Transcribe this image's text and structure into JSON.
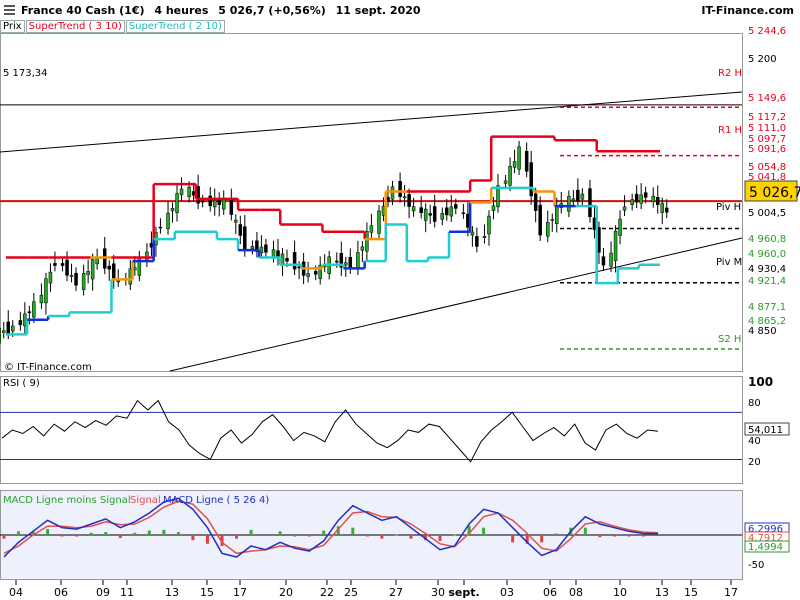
{
  "header": {
    "instrument": "France 40 Cash (1€)",
    "timeframe": "4 heures",
    "last": "5 026,7 (+0,56%)",
    "date": "11 sept. 2020",
    "brand": "IT-Finance.com"
  },
  "legend": {
    "price": "Prix",
    "supertrend_1": "SuperTrend ( 3 10)",
    "supertrend_2": "SuperTrend ( 2 10)"
  },
  "copyright": "© IT-Finance.com",
  "colors": {
    "supertrend_1": "#e8001a",
    "supertrend_2": "#22cccc",
    "supertrend_down": "#f0960a",
    "supertrend_up_dark": "#1030e0",
    "candle_up": "#22aa22",
    "rsi_line": "#000000",
    "macd_line": "#2030c0",
    "signal_line": "#e05050",
    "hist_pos": "#3caa3c",
    "hist_neg": "#e04040"
  },
  "price_panel": {
    "axis_ticks": [
      "5 200",
      "4 850"
    ],
    "current_price": "5 026,7",
    "level_5173": "5 173,34",
    "pivot_tags": [
      "5 244,6",
      "5 149,6",
      "5 117,2",
      "5 111,0",
      "5 097,7",
      "5 091,6",
      "5 054,8",
      "5 041,8",
      "5 004,5",
      "4 960,8",
      "4 960,0",
      "4 930,4",
      "4 921,4",
      "4 877,1",
      "4 865,2"
    ],
    "pivot_labels": {
      "r2": "R2 H",
      "r1": "R1 H",
      "piv": "Piv H",
      "piv_m": "Piv M",
      "s2": "S2 H"
    }
  },
  "chart_data": [
    {
      "type": "candlestick",
      "title": "France 40 Cash (1€)",
      "x_ticks": [
        "04",
        "06",
        "09",
        "11",
        "13",
        "15",
        "17",
        "20",
        "22",
        "25",
        "27",
        "30",
        "sept.",
        "03",
        "06",
        "08",
        "10",
        "13",
        "15",
        "17"
      ],
      "ylim": [
        4810,
        5270
      ],
      "y_ticks": [
        5200,
        4850
      ],
      "current_price": 5026.7,
      "horizontal_levels": [
        5173.34,
        5041.8
      ],
      "supertrend_3_10": [
        4965,
        4965,
        4965,
        4965,
        4965,
        4965,
        4965,
        5065,
        5065,
        5045,
        5045,
        5030,
        5030,
        5010,
        5010,
        5000,
        5000,
        4990,
        5055,
        5055,
        5055,
        5055,
        5070,
        5130,
        5130,
        5130,
        5125,
        5125,
        5110,
        5110,
        5110,
        5110
      ],
      "supertrend_2_10": [
        4860,
        4880,
        4885,
        4890,
        4890,
        4935,
        4960,
        4990,
        5000,
        5000,
        4990,
        4975,
        4965,
        4955,
        4950,
        4955,
        4950,
        4960,
        5010,
        4960,
        4965,
        5000,
        5040,
        5060,
        5060,
        5055,
        5035,
        5035,
        4930,
        4950,
        4955,
        4955
      ],
      "approx_close": [
        4870,
        4900,
        4960,
        4930,
        4965,
        4930,
        4960,
        5010,
        5060,
        5040,
        5040,
        4980,
        4975,
        4960,
        4940,
        4960,
        4955,
        5010,
        5060,
        5030,
        5020,
        5035,
        4980,
        5060,
        5110,
        5000,
        5040,
        5050,
        4950,
        5040,
        5050,
        5026.7
      ],
      "pivots": {
        "r2": 5170,
        "r1": 5104,
        "piv": 5004.5,
        "piv_m": 4930.4,
        "s2": 4840
      }
    },
    {
      "type": "line",
      "title": "RSI ( 9)",
      "ylim": [
        10,
        100
      ],
      "y_ticks": [
        100,
        80,
        40,
        20
      ],
      "bands": [
        70,
        30
      ],
      "last_value": "54,011",
      "values": [
        48,
        55,
        52,
        58,
        50,
        60,
        54,
        62,
        57,
        63,
        59,
        67,
        65,
        80,
        72,
        80,
        62,
        55,
        42,
        35,
        30,
        48,
        55,
        44,
        51,
        62,
        68,
        58,
        46,
        53,
        50,
        45,
        62,
        72,
        60,
        52,
        44,
        40,
        46,
        55,
        53,
        60,
        58,
        48,
        38,
        28,
        45,
        55,
        62,
        70,
        58,
        46,
        52,
        57,
        50,
        60,
        44,
        38,
        55,
        60,
        52,
        48,
        55,
        54.011
      ]
    },
    {
      "type": "line",
      "title": "MACD Ligne ( 5 26 4)",
      "series": [
        {
          "name": "MACD Ligne",
          "values": [
            -30,
            -10,
            5,
            20,
            10,
            8,
            15,
            22,
            10,
            18,
            30,
            45,
            50,
            35,
            10,
            -25,
            -30,
            -15,
            -20,
            -10,
            -18,
            -22,
            -8,
            20,
            40,
            30,
            20,
            25,
            10,
            -5,
            -20,
            -15,
            15,
            35,
            30,
            10,
            -10,
            -28,
            -20,
            5,
            25,
            15,
            10,
            5,
            2,
            2
          ]
        },
        {
          "name": "Signal",
          "values": [
            -25,
            -15,
            0,
            12,
            12,
            10,
            12,
            18,
            14,
            15,
            24,
            38,
            46,
            42,
            22,
            -10,
            -25,
            -22,
            -20,
            -15,
            -16,
            -20,
            -14,
            8,
            30,
            32,
            25,
            24,
            15,
            2,
            -12,
            -16,
            2,
            25,
            30,
            20,
            2,
            -18,
            -22,
            -5,
            15,
            18,
            12,
            7,
            4,
            3
          ]
        },
        {
          "name": "MACD Ligne moins Signal",
          "values": [
            -5,
            5,
            5,
            8,
            -2,
            -2,
            3,
            4,
            -4,
            3,
            6,
            7,
            4,
            -7,
            -12,
            -15,
            -5,
            7,
            0,
            5,
            -2,
            -2,
            6,
            12,
            10,
            -2,
            -5,
            1,
            -5,
            -7,
            -8,
            1,
            13,
            10,
            0,
            -10,
            -12,
            -10,
            2,
            10,
            10,
            -3,
            -2,
            -2,
            -2,
            -1
          ]
        }
      ],
      "ylim": [
        -60,
        60
      ],
      "y_ticks": [
        -50
      ],
      "last_values": [
        "6,2996",
        "4,7912",
        "1,4994"
      ]
    }
  ],
  "rsi_panel": {
    "label": "RSI ( 9)",
    "ticks": [
      "100",
      "80",
      "40",
      "20"
    ],
    "last": "54,011"
  },
  "macd_panel": {
    "label_hist": "MACD Ligne moins Signal",
    "label_signal": "Signal",
    "label_macd": "MACD Ligne ( 5 26 4)",
    "ticks": [
      "-50"
    ],
    "last_macd": "6,2996",
    "last_signal": "4,7912",
    "last_hist": "1,4994"
  },
  "x_axis": [
    "04",
    "06",
    "09",
    "11",
    "13",
    "15",
    "17",
    "20",
    "22",
    "25",
    "27",
    "30",
    "sept.",
    "03",
    "06",
    "08",
    "10",
    "13",
    "15",
    "17"
  ]
}
